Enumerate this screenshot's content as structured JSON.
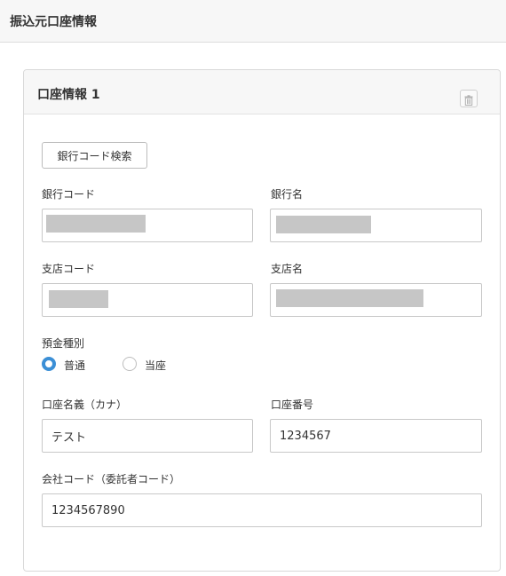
{
  "page": {
    "title": "振込元口座情報"
  },
  "card": {
    "title": "口座情報 1",
    "delete_icon": "trash-icon"
  },
  "search": {
    "label": "銀行コード検索"
  },
  "fields": {
    "bank_code": {
      "label": "銀行コード",
      "value": ""
    },
    "bank_name": {
      "label": "銀行名",
      "value": ""
    },
    "branch_code": {
      "label": "支店コード",
      "value": ""
    },
    "branch_name": {
      "label": "支店名",
      "value": ""
    },
    "deposit_type": {
      "label": "預金種別",
      "options": [
        {
          "label": "普通",
          "selected": true
        },
        {
          "label": "当座",
          "selected": false
        }
      ]
    },
    "account_name": {
      "label": "口座名義（カナ）",
      "value": "テスト"
    },
    "account_number": {
      "label": "口座番号",
      "value": "1234567"
    },
    "company_code": {
      "label": "会社コード（委託者コード）",
      "value": "1234567890"
    }
  },
  "colors": {
    "accent": "#3b8fd6",
    "redacted": "#c6c6c6",
    "header_bg": "#f7f7f7"
  }
}
